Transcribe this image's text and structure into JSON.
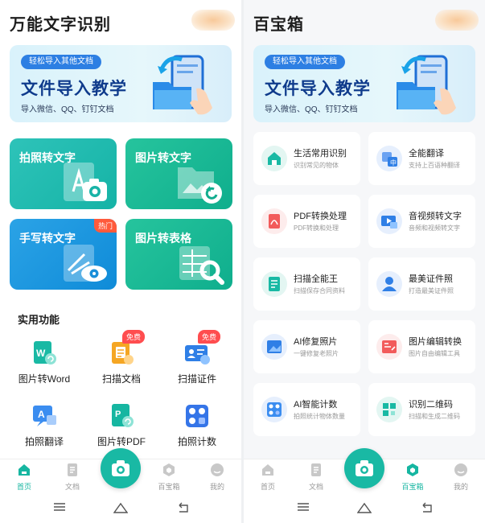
{
  "colors": {
    "accent": "#16b6a1",
    "banner_title": "#0f3b8c",
    "hot": "#ff5a3c",
    "free": "#ff4d4f"
  },
  "left": {
    "title": "万能文字识别",
    "banner": {
      "chip": "轻松导入其他文档",
      "title": "文件导入教学",
      "subtitle": "导入微信、QQ、钉钉文档"
    },
    "cards": [
      {
        "label": "拍照转文字",
        "icon": "camera-icon"
      },
      {
        "label": "图片转文字",
        "icon": "image-rotate-icon"
      },
      {
        "label": "手写转文字",
        "icon": "eye-icon",
        "badge": "热门"
      },
      {
        "label": "图片转表格",
        "icon": "table-search-icon"
      }
    ],
    "section_title": "实用功能",
    "tools": [
      {
        "label": "图片转Word",
        "icon": "word-icon"
      },
      {
        "label": "扫描文档",
        "icon": "scan-doc-icon",
        "badge": "免费"
      },
      {
        "label": "扫描证件",
        "icon": "id-card-icon",
        "badge": "免费"
      },
      {
        "label": "拍照翻译",
        "icon": "translate-icon"
      },
      {
        "label": "图片转PDF",
        "icon": "pdf-icon"
      },
      {
        "label": "拍照计数",
        "icon": "count-icon"
      }
    ]
  },
  "right": {
    "title": "百宝箱",
    "banner": {
      "chip": "轻松导入其他文档",
      "title": "文件导入教学",
      "subtitle": "导入微信、QQ、钉钉文档"
    },
    "items": [
      {
        "title": "生活常用识别",
        "subtitle": "识别常见的物体",
        "icon": "home-scan-icon"
      },
      {
        "title": "全能翻译",
        "subtitle": "支持上百语种翻译",
        "icon": "translate-icon"
      },
      {
        "title": "PDF转换处理",
        "subtitle": "PDF转换和处理",
        "icon": "pdf-icon"
      },
      {
        "title": "音视频转文字",
        "subtitle": "音频和视频转文字",
        "icon": "video-icon"
      },
      {
        "title": "扫描全能王",
        "subtitle": "扫描保存合同资料",
        "icon": "scan-doc-icon"
      },
      {
        "title": "最美证件照",
        "subtitle": "打造最美证件照",
        "icon": "person-icon"
      },
      {
        "title": "AI修复照片",
        "subtitle": "一键修复老照片",
        "icon": "photo-repair-icon"
      },
      {
        "title": "图片编辑转换",
        "subtitle": "图片自由编辑工具",
        "icon": "image-edit-icon"
      },
      {
        "title": "AI智能计数",
        "subtitle": "拍照统计物体数量",
        "icon": "count-icon"
      },
      {
        "title": "识别二维码",
        "subtitle": "扫描和生成二维码",
        "icon": "qrcode-icon"
      }
    ]
  },
  "tabs": [
    {
      "label": "首页",
      "icon": "home-icon"
    },
    {
      "label": "文档",
      "icon": "document-icon"
    },
    {
      "label": "百宝箱",
      "icon": "toolbox-icon"
    },
    {
      "label": "我的",
      "icon": "profile-icon"
    }
  ]
}
